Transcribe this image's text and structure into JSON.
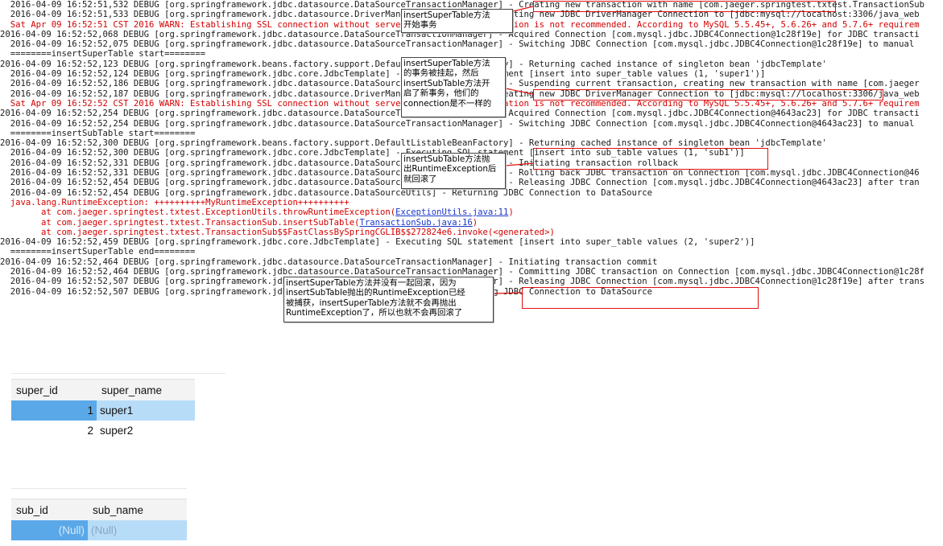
{
  "console": {
    "lines": [
      {
        "text": "  2016-04-09 16:52:51,532 DEBUG [org.springframework.jdbc.datasource.DataSourceTransactionManager] - Creating new transaction with name [com.jaeger.springtest.txtest.TransactionSub",
        "style": "normal"
      },
      {
        "text": "  2016-04-09 16:52:51,533 DEBUG [org.springframework.jdbc.datasource.DriverManagerDataSource] - Creating new JDBC DriverManager Connection to [jdbc:mysql://localhost:3306/java_web",
        "style": "normal"
      },
      {
        "text": "  Sat Apr 09 16:52:51 CST 2016 WARN: Establishing SSL connection without server's identity verification is not recommended. According to MySQL 5.5.45+, 5.6.26+ and 5.7.6+ requirem",
        "style": "red"
      },
      {
        "text": "2016-04-09 16:52:52,068 DEBUG [org.springframework.jdbc.datasource.DataSourceTransactionManager] - Acquired Connection [com.mysql.jdbc.JDBC4Connection@1c28f19e] for JDBC transacti",
        "style": "normal"
      },
      {
        "text": "  2016-04-09 16:52:52,075 DEBUG [org.springframework.jdbc.datasource.DataSourceTransactionManager] - Switching JDBC Connection [com.mysql.jdbc.JDBC4Connection@1c28f19e] to manual",
        "style": "normal"
      },
      {
        "text": "  ========insertSuperTable start========",
        "style": "normal"
      },
      {
        "text": "2016-04-09 16:52:52,123 DEBUG [org.springframework.beans.factory.support.DefaultListableBeanFactory] - Returning cached instance of singleton bean 'jdbcTemplate'",
        "style": "normal"
      },
      {
        "text": "  2016-04-09 16:52:52,124 DEBUG [org.springframework.jdbc.core.JdbcTemplate] - Executing SQL statement [insert into super_table values (1, 'super1')]",
        "style": "normal"
      },
      {
        "text": "  2016-04-09 16:52:52,186 DEBUG [org.springframework.jdbc.datasource.DataSourceTransactionManager] - Suspending current transaction, creating new transaction with name [com.jaeger",
        "style": "normal"
      },
      {
        "text": "  2016-04-09 16:52:52,187 DEBUG [org.springframework.jdbc.datasource.DriverManagerDataSource] - Creating new JDBC DriverManager Connection to [jdbc:mysql://localhost:3306/java_web",
        "style": "normal"
      },
      {
        "text": "  Sat Apr 09 16:52:52 CST 2016 WARN: Establishing SSL connection without server's identity verification is not recommended. According to MySQL 5.5.45+, 5.6.26+ and 5.7.6+ requirem",
        "style": "red"
      },
      {
        "text": "2016-04-09 16:52:52,254 DEBUG [org.springframework.jdbc.datasource.DataSourceTransactionManager] - Acquired Connection [com.mysql.jdbc.JDBC4Connection@4643ac23] for JDBC transacti",
        "style": "normal"
      },
      {
        "text": "  2016-04-09 16:52:52,254 DEBUG [org.springframework.jdbc.datasource.DataSourceTransactionManager] - Switching JDBC Connection [com.mysql.jdbc.JDBC4Connection@4643ac23] to manual",
        "style": "normal"
      },
      {
        "text": "  ========insertSubTable start========",
        "style": "normal"
      },
      {
        "text": "2016-04-09 16:52:52,300 DEBUG [org.springframework.beans.factory.support.DefaultListableBeanFactory] - Returning cached instance of singleton bean 'jdbcTemplate'",
        "style": "normal"
      },
      {
        "text": "  2016-04-09 16:52:52,300 DEBUG [org.springframework.jdbc.core.JdbcTemplate] - Executing SQL statement [insert into sub_table values (1, 'sub1')]",
        "style": "normal"
      },
      {
        "text": "  2016-04-09 16:52:52,331 DEBUG [org.springframework.jdbc.datasource.DataSourceTransactionManager] - Initiating transaction rollback",
        "style": "normal"
      },
      {
        "text": "  2016-04-09 16:52:52,331 DEBUG [org.springframework.jdbc.datasource.DataSourceTransactionManager] - Rolling back JDBC transaction on Connection [com.mysql.jdbc.JDBC4Connection@46",
        "style": "normal"
      },
      {
        "text": "  2016-04-09 16:52:52,454 DEBUG [org.springframework.jdbc.datasource.DataSourceTransactionManager] - Releasing JDBC Connection [com.mysql.jdbc.JDBC4Connection@4643ac23] after tran",
        "style": "normal"
      },
      {
        "text": "  2016-04-09 16:52:52,454 DEBUG [org.springframework.jdbc.datasource.DataSourceUtils] - Returning JDBC Connection to DataSource",
        "style": "normal"
      },
      {
        "text": "  java.lang.RuntimeException: ++++++++++MyRuntimeException++++++++++",
        "style": "red"
      },
      {
        "text": "",
        "style": "stack",
        "pre": "        at com.jaeger.springtest.txtest.ExceptionUtils.throwRuntimeException(",
        "link": "ExceptionUtils.java:11",
        "post": ")"
      },
      {
        "text": "",
        "style": "stack",
        "pre": "        at com.jaeger.springtest.txtest.TransactionSub.insertSubTable(",
        "link": "TransactionSub.java:16",
        "post": ")"
      },
      {
        "text": "        at com.jaeger.springtest.txtest.TransactionSub$$FastClassBySpringCGLIB$$272824e6.invoke(<generated>)",
        "style": "red"
      },
      {
        "text": "2016-04-09 16:52:52,459 DEBUG [org.springframework.jdbc.core.JdbcTemplate] - Executing SQL statement [insert into super_table values (2, 'super2')]",
        "style": "normal"
      },
      {
        "text": "  ========insertSuperTable end========",
        "style": "normal"
      },
      {
        "text": "2016-04-09 16:52:52,464 DEBUG [org.springframework.jdbc.datasource.DataSourceTransactionManager] - Initiating transaction commit",
        "style": "normal"
      },
      {
        "text": "  2016-04-09 16:52:52,464 DEBUG [org.springframework.jdbc.datasource.DataSourceTransactionManager] - Committing JDBC transaction on Connection [com.mysql.jdbc.JDBC4Connection@1c28f",
        "style": "normal"
      },
      {
        "text": "  2016-04-09 16:52:52,507 DEBUG [org.springframework.jdbc.datasource.DataSourceTransactionManager] - Releasing JDBC Connection [com.mysql.jdbc.JDBC4Connection@1c28f19e] after trans",
        "style": "normal"
      },
      {
        "text": "  2016-04-09 16:52:52,507 DEBUG [org.springframework.jdbc.datasource.DataSourceUtils] - Returning JDBC Connection to DataSource",
        "style": "normal"
      }
    ]
  },
  "callouts": [
    {
      "lines": [
        "insertSuperTable方法",
        "开始事务"
      ]
    },
    {
      "lines": [
        "insertSuperTable方法",
        "的事务被挂起，然后",
        "insertSubTable方法开",
        "启了新事务，他们的",
        "connection是不一样的"
      ]
    },
    {
      "lines": [
        "insertSubTable方法抛",
        "出RuntimeException后",
        "就回滚了"
      ]
    },
    {
      "lines": [
        "insertSuperTable方法并没有一起回滚，因为",
        "insertSubTable抛出的RuntimeException已经",
        "被捕获，insertSuperTable方法就不会再抛出",
        "RuntimeException了，所以也就不会再回滚了"
      ]
    }
  ],
  "super_table": {
    "columns": [
      "super_id",
      "super_name"
    ],
    "rows": [
      [
        "1",
        "super1"
      ],
      [
        "2",
        "super2"
      ]
    ]
  },
  "sub_table": {
    "columns": [
      "sub_id",
      "sub_name"
    ],
    "rows": [
      [
        "(Null)",
        "(Null)"
      ]
    ]
  }
}
